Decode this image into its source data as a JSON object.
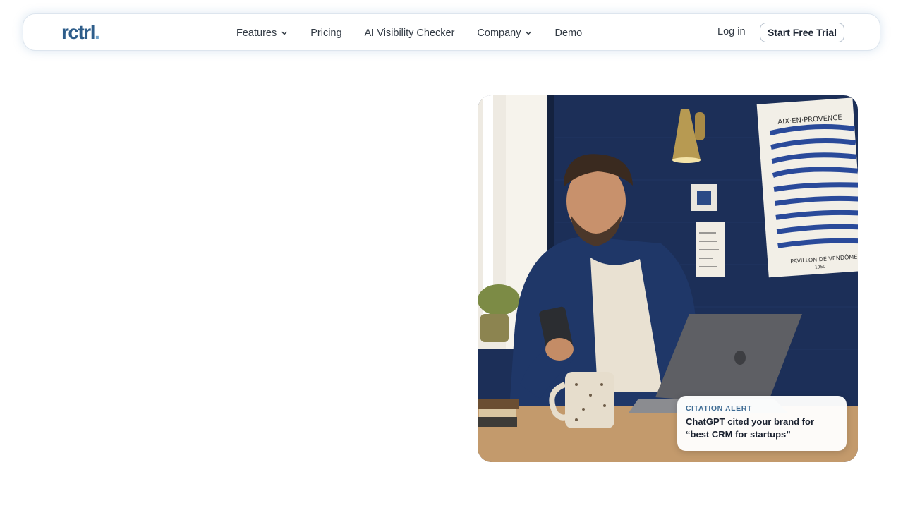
{
  "brand": {
    "logo_text": "rctrl",
    "logo_dot": ".",
    "accent_color": "#2e5d8a"
  },
  "nav": {
    "items": [
      {
        "label": "Features",
        "has_dropdown": true
      },
      {
        "label": "Pricing",
        "has_dropdown": false
      },
      {
        "label": "AI Visibility Checker",
        "has_dropdown": false
      },
      {
        "label": "Company",
        "has_dropdown": true
      },
      {
        "label": "Demo",
        "has_dropdown": false
      }
    ],
    "login_label": "Log in",
    "cta_label": "Start Free Trial"
  },
  "hero": {
    "image_subject": "man at desk looking at phone with laptop and coffee mug",
    "poster_top_text": "AIX·EN·PROVENCE",
    "poster_bottom_text": "PAVILLON DE VENDÔME",
    "poster_year": "1950",
    "alert": {
      "label": "CITATION ALERT",
      "text": "ChatGPT cited your brand for “best CRM for startups”"
    }
  }
}
